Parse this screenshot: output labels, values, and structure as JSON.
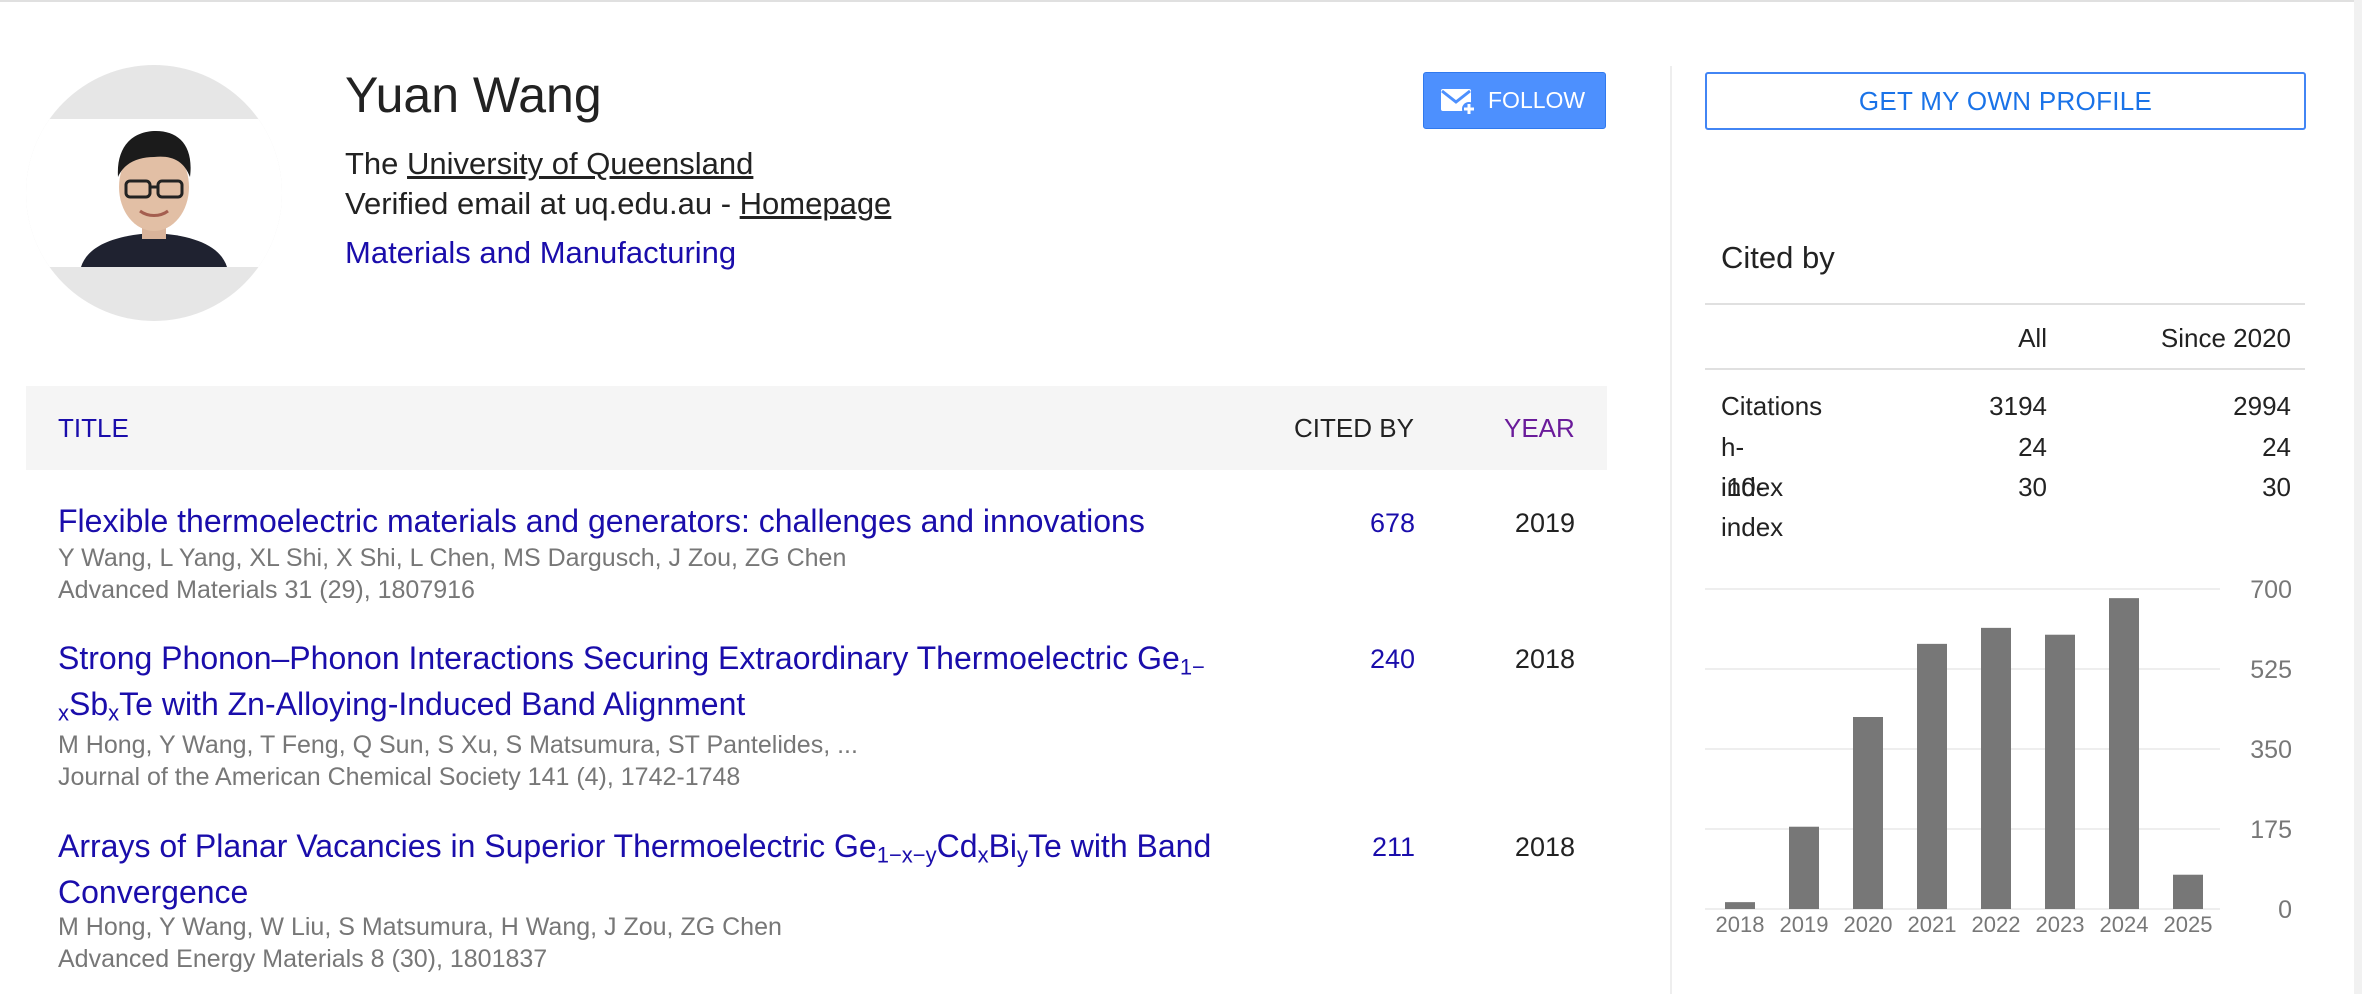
{
  "profile": {
    "name": "Yuan Wang",
    "affiliation_prefix": "The ",
    "affiliation_link": "University of Queensland",
    "email_text": "Verified email at uq.edu.au - ",
    "homepage_link": "Homepage",
    "interest": "Materials and Manufacturing"
  },
  "buttons": {
    "follow": "FOLLOW",
    "get_profile": "GET MY OWN PROFILE"
  },
  "table": {
    "headers": {
      "title": "TITLE",
      "cited_by": "CITED BY",
      "year": "YEAR"
    },
    "rows": [
      {
        "title": "Flexible thermoelectric materials and generators: challenges and innovations",
        "authors": "Y Wang, L Yang, XL Shi, X Shi, L Chen, MS Dargusch, J Zou, ZG Chen",
        "venue": "Advanced Materials 31 (29), 1807916",
        "cited": "678",
        "year": "2019"
      },
      {
        "title_parts": {
          "p1": "Strong Phonon–Phonon Interactions Securing Extraordinary Thermoelectric Ge",
          "s1": "1−",
          "s2": "x",
          "p2": "Sb",
          "s3": "x",
          "p3": "Te with Zn-Alloying-Induced Band Alignment"
        },
        "authors": "M Hong, Y Wang, T Feng, Q Sun, S Xu, S Matsumura, ST Pantelides, ...",
        "venue": "Journal of the American Chemical Society 141 (4), 1742-1748",
        "cited": "240",
        "year": "2018"
      },
      {
        "title_parts": {
          "p1": "Arrays of Planar Vacancies in Superior Thermoelectric Ge",
          "s1": "1−x−y",
          "p2": "Cd",
          "s2": "x",
          "p3": "Bi",
          "s3": "y",
          "p4": "Te with Band Convergence"
        },
        "authors": "M Hong, Y Wang, W Liu, S Matsumura, H Wang, J Zou, ZG Chen",
        "venue": "Advanced Energy Materials 8 (30), 1801837",
        "cited": "211",
        "year": "2018"
      }
    ]
  },
  "cited_by": {
    "title": "Cited by",
    "col_all": "All",
    "col_since": "Since 2020",
    "rows": [
      {
        "label": "Citations",
        "all": "3194",
        "since": "2994"
      },
      {
        "label": "h-index",
        "all": "24",
        "since": "24"
      },
      {
        "label": "i10-index",
        "all": "30",
        "since": "30"
      }
    ]
  },
  "colors": {
    "link": "#1a0dab",
    "follow_bg": "#4d90fe",
    "bar": "#777777",
    "year_header": "#6a1b9a"
  },
  "chart_data": {
    "type": "bar",
    "categories": [
      "2018",
      "2019",
      "2020",
      "2021",
      "2022",
      "2023",
      "2024",
      "2025"
    ],
    "values": [
      15,
      180,
      420,
      580,
      615,
      600,
      680,
      75
    ],
    "ylim": [
      0,
      700
    ],
    "yticks": [
      "0",
      "175",
      "350",
      "525",
      "700"
    ],
    "grid": true
  }
}
